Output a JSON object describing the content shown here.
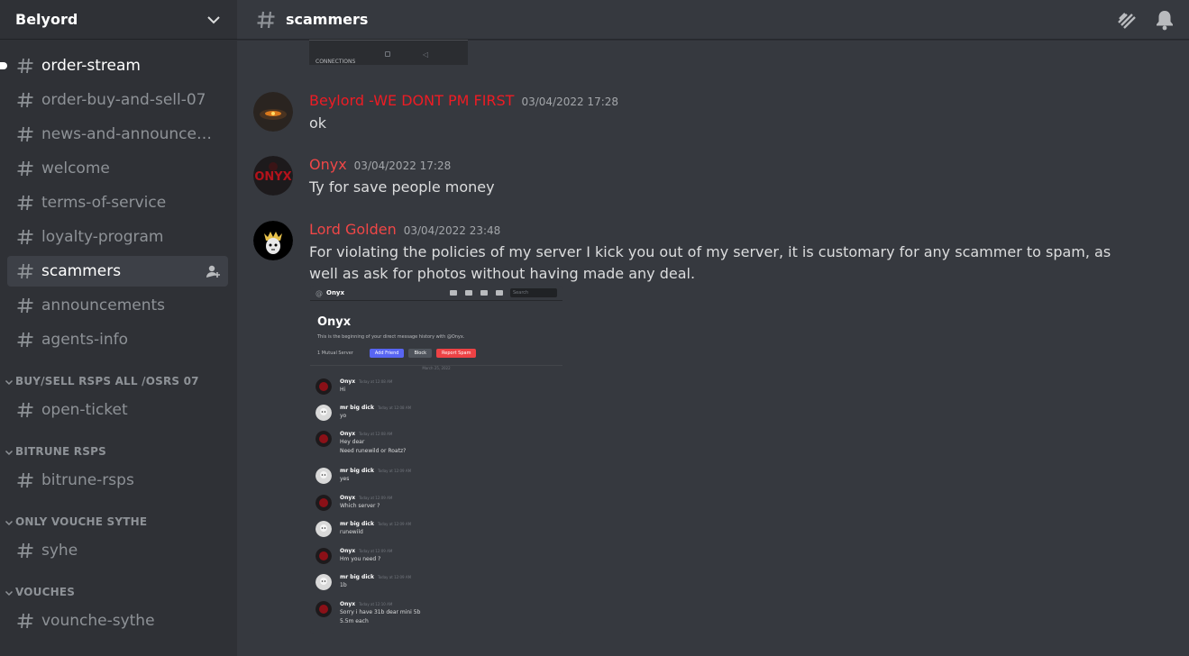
{
  "server": {
    "name": "Belyord"
  },
  "sidebar": {
    "channels_top": [
      {
        "label": "order-stream",
        "state": "unread"
      },
      {
        "label": "order-buy-and-sell-07",
        "state": "normal"
      },
      {
        "label": "news-and-announceme...",
        "state": "normal"
      },
      {
        "label": "welcome",
        "state": "normal"
      },
      {
        "label": "terms-of-service",
        "state": "normal"
      },
      {
        "label": "loyalty-program",
        "state": "normal"
      },
      {
        "label": "scammers",
        "state": "selected"
      },
      {
        "label": "announcements",
        "state": "normal"
      },
      {
        "label": "agents-info",
        "state": "normal"
      }
    ],
    "categories": [
      {
        "label": "BUY/SELL RSPS ALL /OSRS 07",
        "channels": [
          "open-ticket"
        ]
      },
      {
        "label": "BITRUNE RSPS",
        "channels": [
          "bitrune-rsps"
        ]
      },
      {
        "label": "ONLY VOUCHE SYTHE",
        "channels": [
          "syhe"
        ]
      },
      {
        "label": "VOUCHES",
        "channels": [
          "vounche-sythe"
        ]
      }
    ]
  },
  "channel": {
    "title": "scammers"
  },
  "previous_attachment": {
    "caption": "CONNECTIONS"
  },
  "messages": [
    {
      "author": "Beylord  -WE DONT PM FIRST",
      "timestamp": "03/04/2022 17:28",
      "text": "ok",
      "color": "#ed1c24"
    },
    {
      "author": "Onyx",
      "timestamp": "03/04/2022 17:28",
      "text": "Ty for save people money",
      "color": "#f04747"
    },
    {
      "author": "Lord Golden",
      "timestamp": "03/04/2022 23:48",
      "text": "For violating the policies of my server I kick you out of my server, it is customary for any scammer to spam, as well as ask for photos without having made any deal.",
      "color": "#f04747"
    }
  ],
  "attachment": {
    "header_name": "Onyx",
    "search_placeholder": "Search",
    "title": "Onyx",
    "subtitle": "This is the beginning of your direct message history with @Onyx.",
    "mutual": "1 Mutual Server",
    "buttons": [
      "Add Friend",
      "Block",
      "Report Spam"
    ],
    "date_divider": "March 25, 2022",
    "chat": [
      {
        "author": "Onyx",
        "time": "Today at 12:08 AM",
        "lines": [
          "Hi"
        ]
      },
      {
        "author": "mr big dick",
        "time": "Today at 12:08 AM",
        "lines": [
          "yo"
        ]
      },
      {
        "author": "Onyx",
        "time": "Today at 12:08 AM",
        "lines": [
          "Hey dear",
          "Need runewild or Roatz?"
        ]
      },
      {
        "author": "mr big dick",
        "time": "Today at 12:09 AM",
        "lines": [
          "yes"
        ]
      },
      {
        "author": "Onyx",
        "time": "Today at 12:09 AM",
        "lines": [
          "Which server ?"
        ]
      },
      {
        "author": "mr big dick",
        "time": "Today at 12:09 AM",
        "lines": [
          "runewild"
        ]
      },
      {
        "author": "Onyx",
        "time": "Today at 12:09 AM",
        "lines": [
          "Hm you need ?"
        ]
      },
      {
        "author": "mr big dick",
        "time": "Today at 12:09 AM",
        "lines": [
          "1b"
        ]
      },
      {
        "author": "Onyx",
        "time": "Today at 12:10 AM",
        "lines": [
          "Sorry i have 31b dear mini 5b",
          "5.5m each"
        ]
      }
    ]
  },
  "colors": {
    "accent": "#5865f2",
    "sidebar_bg": "#2f3136",
    "chat_bg": "#36393f"
  }
}
